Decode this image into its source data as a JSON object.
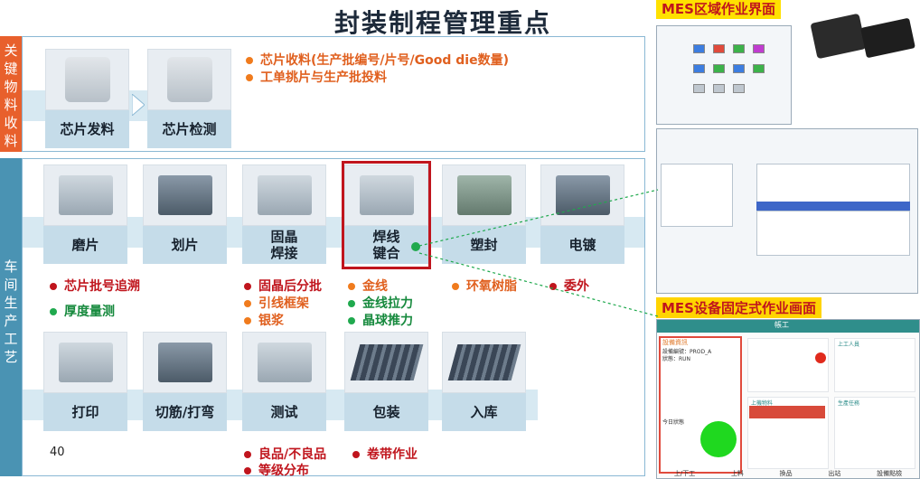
{
  "title": "封装制程管理重点",
  "sidebar": {
    "top_label": [
      "关",
      "键",
      "物",
      "料",
      "收",
      "料"
    ],
    "bottom_label": [
      "车",
      "间",
      "生",
      "产",
      "工",
      "艺"
    ]
  },
  "top_row": [
    {
      "label": "芯片发料"
    },
    {
      "label": "芯片检测"
    }
  ],
  "top_bullets": [
    "芯片收料(生产批编号/片号/Good die数量)",
    "工单挑片与生产批投料"
  ],
  "row2": [
    {
      "label": "磨片"
    },
    {
      "label": "划片"
    },
    {
      "label": "固晶\n焊接"
    },
    {
      "label": "焊线\n键合"
    },
    {
      "label": "塑封"
    },
    {
      "label": "电镀"
    }
  ],
  "row2_bullets": {
    "col1": [
      "芯片批号追溯",
      "厚度量测"
    ],
    "col2": [
      "固晶后分批",
      "引线框架",
      "银浆"
    ],
    "col3": [
      "金线",
      "金线拉力",
      "晶球推力"
    ],
    "col4": [
      "环氧树脂"
    ],
    "col5": [
      "委外"
    ]
  },
  "row3": [
    {
      "label": "打印"
    },
    {
      "label": "切筋/打弯"
    },
    {
      "label": "测试"
    },
    {
      "label": "包装"
    },
    {
      "label": "入库"
    }
  ],
  "row3_bullets": {
    "line1a": "良品/不良品",
    "line1b": "卷带作业",
    "line2": "等级分布"
  },
  "page_number": "40",
  "right": {
    "mes_area_title": "MES区域作业界面",
    "mes_equip_title": "MES设备固定式作业画面",
    "equip_screen": {
      "header": "帳工",
      "equip_info": "設備資訊",
      "equip_code": "設備編號：PROD_A",
      "status": "狀態：RUN",
      "today_eff": "今日狀態",
      "on_station": "上工人員",
      "feed": "上機物料",
      "production_tasks": "生產任務",
      "foot_buttons": [
        "上/下工",
        "上料",
        "換品",
        "出站",
        "設備點檢"
      ]
    }
  },
  "colors": {
    "accent_red": "#c0151d",
    "orange": "#e8602c",
    "blue_side": "#4a93b3",
    "green": "#20a94e"
  }
}
